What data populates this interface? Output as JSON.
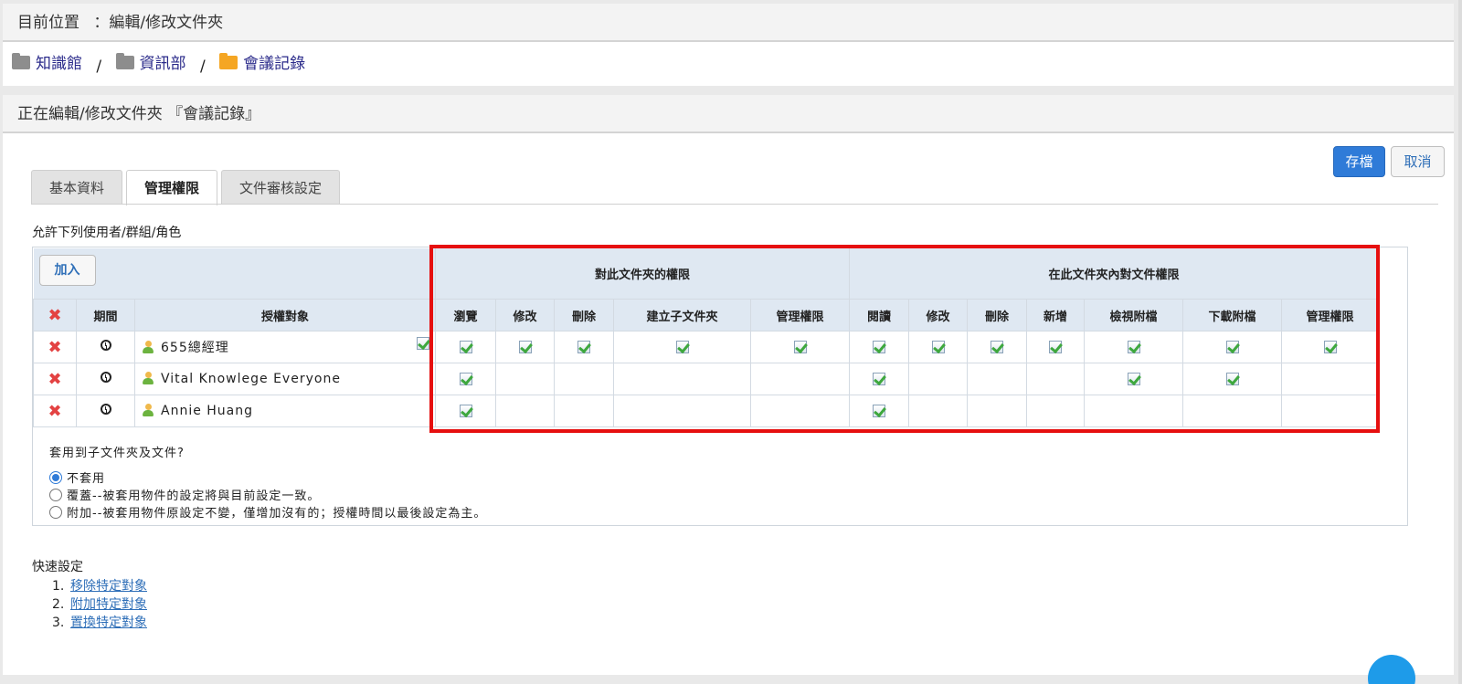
{
  "location": {
    "prefix": "目前位置",
    "colon": "：",
    "path": "編輯/修改文件夾"
  },
  "breadcrumb": [
    {
      "label": "知識館",
      "icon": "folder-grey-icon"
    },
    {
      "label": "資訊部",
      "icon": "folder-grey-icon"
    },
    {
      "label": "會議記錄",
      "icon": "folder-orange-icon"
    }
  ],
  "breadcrumb_sep": "/",
  "editing_title": "正在編輯/修改文件夾 『會議記錄』",
  "buttons": {
    "save": "存檔",
    "cancel": "取消",
    "add": "加入"
  },
  "tabs": [
    {
      "label": "基本資料",
      "active": false
    },
    {
      "label": "管理權限",
      "active": true
    },
    {
      "label": "文件審核設定",
      "active": false
    }
  ],
  "allow_label": "允許下列使用者/群組/角色",
  "table": {
    "group_folder": "對此文件夾的權限",
    "group_docs": "在此文件夾內對文件權限",
    "col_period": "期間",
    "col_subject": "授權對象",
    "folder_cols": [
      "瀏覽",
      "修改",
      "刪除",
      "建立子文件夾",
      "管理權限"
    ],
    "doc_cols": [
      "閱讀",
      "修改",
      "刪除",
      "新增",
      "檢視附檔",
      "下載附檔",
      "管理權限"
    ],
    "rows": [
      {
        "subject": "655總經理",
        "folder": [
          true,
          true,
          true,
          true,
          true
        ],
        "docs": [
          true,
          true,
          true,
          true,
          true,
          true,
          true
        ]
      },
      {
        "subject": "Vital Knowlege Everyone",
        "folder": [
          true,
          false,
          false,
          false,
          false
        ],
        "docs": [
          true,
          false,
          false,
          false,
          true,
          true,
          false
        ]
      },
      {
        "subject": "Annie Huang",
        "folder": [
          true,
          false,
          false,
          false,
          false
        ],
        "docs": [
          true,
          false,
          false,
          false,
          false,
          false,
          false
        ]
      }
    ]
  },
  "apply": {
    "question": "套用到子文件夾及文件?",
    "options": [
      {
        "label": "不套用",
        "selected": true
      },
      {
        "label": "覆蓋--被套用物件的設定將與目前設定一致。",
        "selected": false
      },
      {
        "label": "附加--被套用物件原設定不變，僅增加沒有的；授權時間以最後設定為主。",
        "selected": false
      }
    ]
  },
  "quick": {
    "title": "快速設定",
    "items": [
      {
        "num": "1.",
        "label": "移除特定對象"
      },
      {
        "num": "2.",
        "label": "附加特定對象"
      },
      {
        "num": "3.",
        "label": "置換特定對象"
      }
    ]
  },
  "colors": {
    "accent": "#2f7bd8",
    "highlight_box": "#e60f0f",
    "header_bg": "#dfe8f2",
    "fab": "#1e9be9"
  }
}
